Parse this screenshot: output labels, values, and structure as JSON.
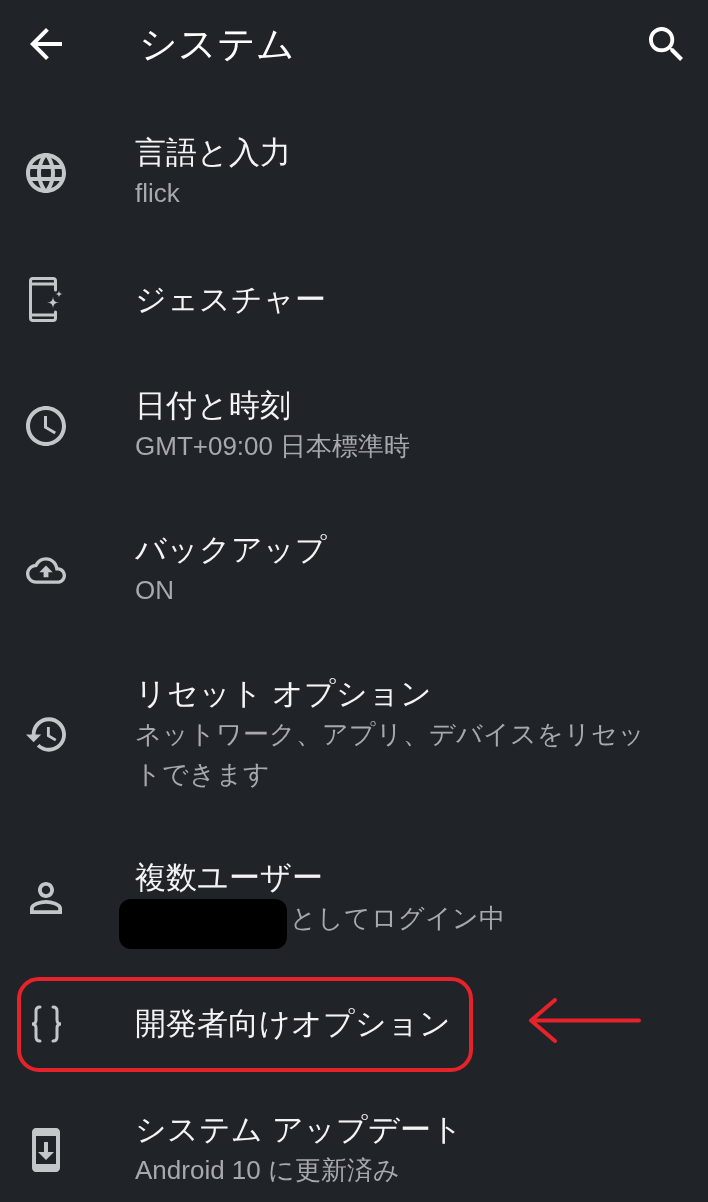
{
  "app_bar": {
    "title": "システム"
  },
  "items": [
    {
      "title": "言語と入力",
      "subtitle": "flick",
      "highlighted": false
    },
    {
      "title": "ジェスチャー",
      "highlighted": false
    },
    {
      "title": "日付と時刻",
      "subtitle": "GMT+09:00 日本標準時",
      "highlighted": false
    },
    {
      "title": "バックアップ",
      "subtitle": "ON",
      "highlighted": false
    },
    {
      "title": "リセット オプション",
      "subtitle": "ネットワーク、アプリ、デバイスをリセットできます",
      "highlighted": false
    },
    {
      "title": "複数ユーザー",
      "subtitle": "としてログイン中",
      "subtitle_redacted": true,
      "highlighted": false
    },
    {
      "title": "開発者向けオプション",
      "highlighted": true
    },
    {
      "title": "システム アップデート",
      "subtitle": "Android 10 に更新済み",
      "highlighted": false
    }
  ]
}
